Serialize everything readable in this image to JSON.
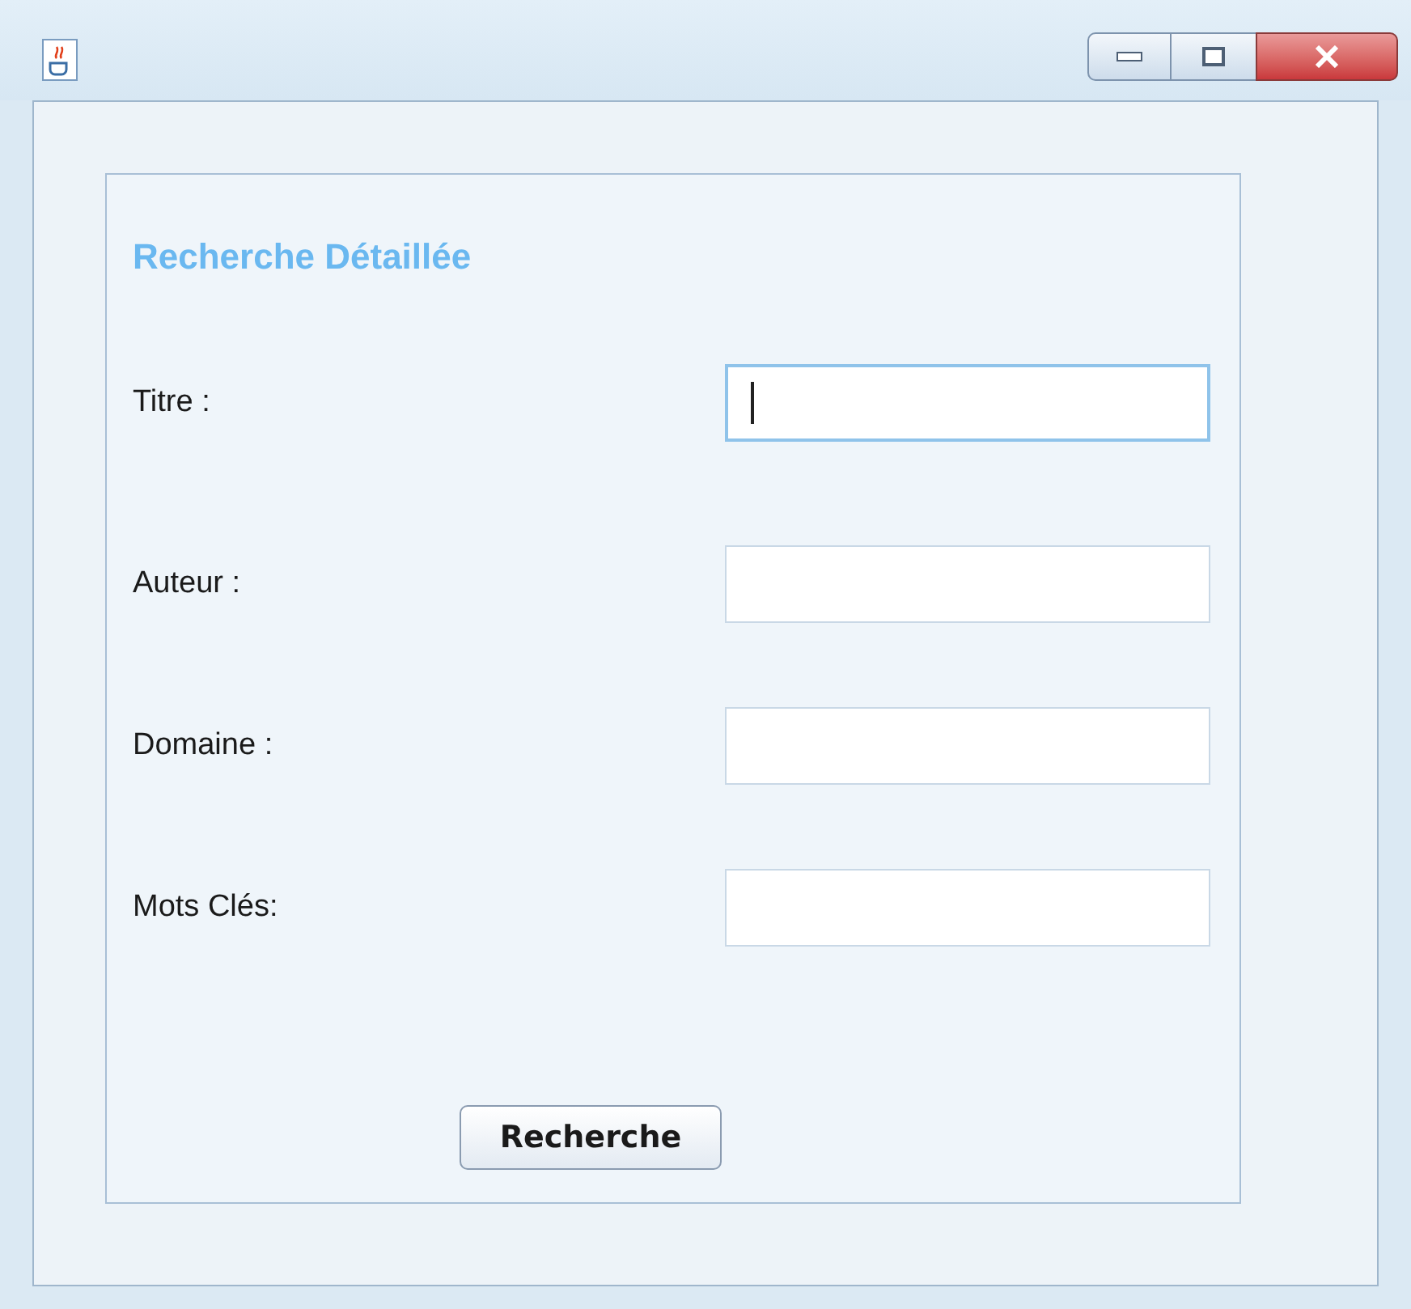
{
  "form": {
    "title": "Recherche Détaillée",
    "fields": [
      {
        "label": "Titre :",
        "focused": true
      },
      {
        "label": "Auteur :",
        "focused": false
      },
      {
        "label": "Domaine :",
        "focused": false
      },
      {
        "label": "Mots Clés:",
        "focused": false
      }
    ],
    "button": "Recherche"
  }
}
